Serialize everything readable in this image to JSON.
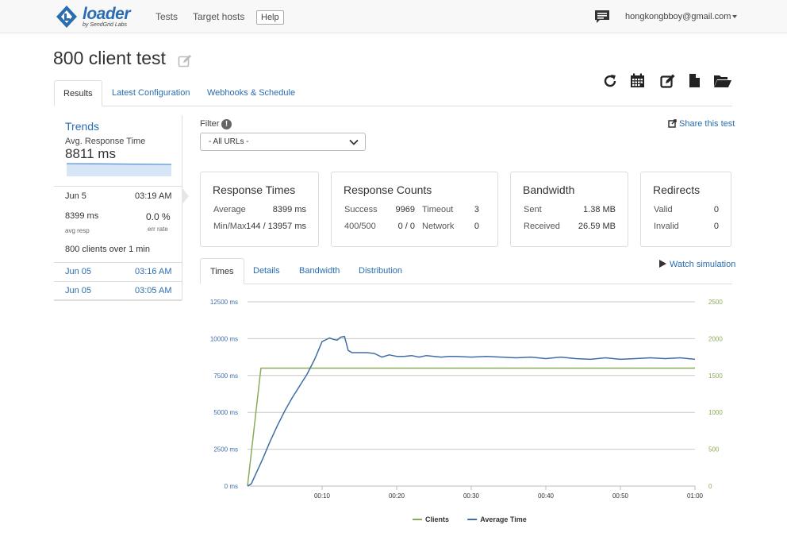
{
  "nav": {
    "brand": "loader",
    "brand_sub": "by SendGrid Labs",
    "links": [
      "Tests",
      "Target hosts"
    ],
    "help": "Help",
    "user_email": "hongkongbboy@gmail.com"
  },
  "page": {
    "title": "800 client test",
    "tabs": [
      "Results",
      "Latest Configuration",
      "Webhooks & Schedule"
    ],
    "active_tab": "Results"
  },
  "toolbar_icons": [
    "refresh-icon",
    "calendar-icon",
    "edit-icon",
    "file-icon",
    "folder-open-icon"
  ],
  "trends": {
    "title": "Trends",
    "subtitle": "Avg. Response Time",
    "value": "8811 ms",
    "active_run": {
      "date": "Jun 5",
      "time": "03:19 AM",
      "avg_resp_value": "8399 ms",
      "avg_resp_label": "avg resp",
      "err_rate_value": "0.0 %",
      "err_rate_label": "err rate",
      "summary": "800 clients over 1 min"
    },
    "runs": [
      {
        "date": "Jun 05",
        "time": "03:16 AM"
      },
      {
        "date": "Jun 05",
        "time": "03:05 AM"
      }
    ]
  },
  "filter": {
    "label": "Filter",
    "info": "!",
    "selected": "- All URLs -"
  },
  "share": "Share this test",
  "stats": {
    "response_times": {
      "title": "Response Times",
      "rows": [
        {
          "label": "Average",
          "value": "8399 ms"
        },
        {
          "label": "Min/Max",
          "value": "144 / 13957 ms"
        }
      ]
    },
    "response_counts": {
      "title": "Response Counts",
      "rows": [
        {
          "label": "Success",
          "value": "9969",
          "label2": "Timeout",
          "value2": "3"
        },
        {
          "label": "400/500",
          "value": "0 / 0",
          "label2": "Network",
          "value2": "0"
        }
      ]
    },
    "bandwidth": {
      "title": "Bandwidth",
      "rows": [
        {
          "label": "Sent",
          "value": "1.38 MB"
        },
        {
          "label": "Received",
          "value": "26.59 MB"
        }
      ]
    },
    "redirects": {
      "title": "Redirects",
      "rows": [
        {
          "label": "Valid",
          "value": "0"
        },
        {
          "label": "Invalid",
          "value": "0"
        }
      ]
    }
  },
  "watch": "Watch simulation",
  "chart_tabs": [
    "Times",
    "Details",
    "Bandwidth",
    "Distribution"
  ],
  "chart_data": {
    "type": "line",
    "x_ticks": [
      "00:10",
      "00:20",
      "00:30",
      "00:40",
      "00:50",
      "01:00"
    ],
    "y_left_ticks": [
      "0 ms",
      "2500 ms",
      "5000 ms",
      "7500 ms",
      "10000 ms",
      "12500 ms"
    ],
    "y_right_ticks": [
      "0",
      "500",
      "1000",
      "1500",
      "2000",
      "2500"
    ],
    "ylim_left": [
      0,
      12500
    ],
    "ylim_right": [
      0,
      2500
    ],
    "xlim": [
      0,
      60
    ],
    "grid": true,
    "legend": "bottom",
    "series": [
      {
        "name": "Clients",
        "axis": "right",
        "color": "#8aac5a",
        "x": [
          0,
          1.8,
          60
        ],
        "values": [
          0,
          1600,
          1600
        ]
      },
      {
        "name": "Average Time",
        "axis": "left",
        "color": "#3f6ea6",
        "x": [
          0,
          0.5,
          1,
          2,
          3,
          4,
          5,
          6,
          7,
          8,
          9,
          10,
          11,
          11.5,
          12,
          12.5,
          13,
          13.5,
          14,
          15,
          16,
          17,
          18,
          19,
          20,
          21,
          22,
          23,
          24,
          25,
          26,
          27,
          28,
          30,
          32,
          34,
          36,
          38,
          40,
          42,
          44,
          46,
          48,
          50,
          52,
          54,
          56,
          58,
          60
        ],
        "values": [
          0,
          150,
          700,
          1800,
          3000,
          4100,
          5100,
          6000,
          6800,
          7600,
          8600,
          9800,
          10050,
          9950,
          9900,
          10100,
          10150,
          9200,
          9050,
          9050,
          9050,
          9000,
          8750,
          8900,
          8800,
          8800,
          8850,
          8750,
          8850,
          8800,
          8750,
          8800,
          8800,
          8750,
          8800,
          8750,
          8700,
          8750,
          8650,
          8750,
          8650,
          8600,
          8700,
          8600,
          8650,
          8700,
          8650,
          8700,
          8600
        ]
      }
    ]
  }
}
